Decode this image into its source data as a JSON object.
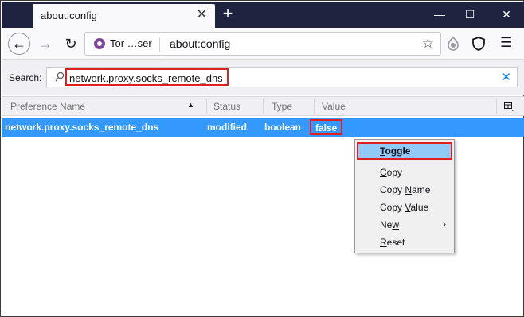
{
  "tab": {
    "title": "about:config",
    "close_glyph": "✕"
  },
  "newtab_glyph": "+",
  "window": {
    "minimize": "—",
    "maximize": "☐",
    "close": "✕"
  },
  "nav": {
    "back_glyph": "←",
    "forward_glyph": "→",
    "reload_glyph": "↻",
    "tor_label": "Tor …ser",
    "url": "about:config",
    "star_glyph": "☆",
    "menu_glyph": "☰"
  },
  "search": {
    "label": "Search:",
    "value": "network.proxy.socks_remote_dns",
    "clear_glyph": "✕"
  },
  "columns": {
    "name": "Preference Name",
    "sort_glyph": "▲",
    "status": "Status",
    "type": "Type",
    "value": "Value"
  },
  "rows": [
    {
      "name": "network.proxy.socks_remote_dns",
      "status": "modified",
      "type": "boolean",
      "value": "false"
    }
  ],
  "context_menu": {
    "items": [
      {
        "pre": "",
        "key": "T",
        "post": "oggle"
      },
      {
        "pre": "",
        "key": "C",
        "post": "opy"
      },
      {
        "pre": "Copy ",
        "key": "N",
        "post": "ame"
      },
      {
        "pre": "Copy ",
        "key": "V",
        "post": "alue"
      },
      {
        "pre": "Ne",
        "key": "w",
        "post": ""
      },
      {
        "pre": "",
        "key": "R",
        "post": "eset"
      }
    ],
    "submenu_arrow": "›"
  },
  "colors": {
    "titlebar": "#202340",
    "selection": "#3399ff",
    "highlight_box": "#e02020",
    "menu_hover": "#91c9f7"
  }
}
